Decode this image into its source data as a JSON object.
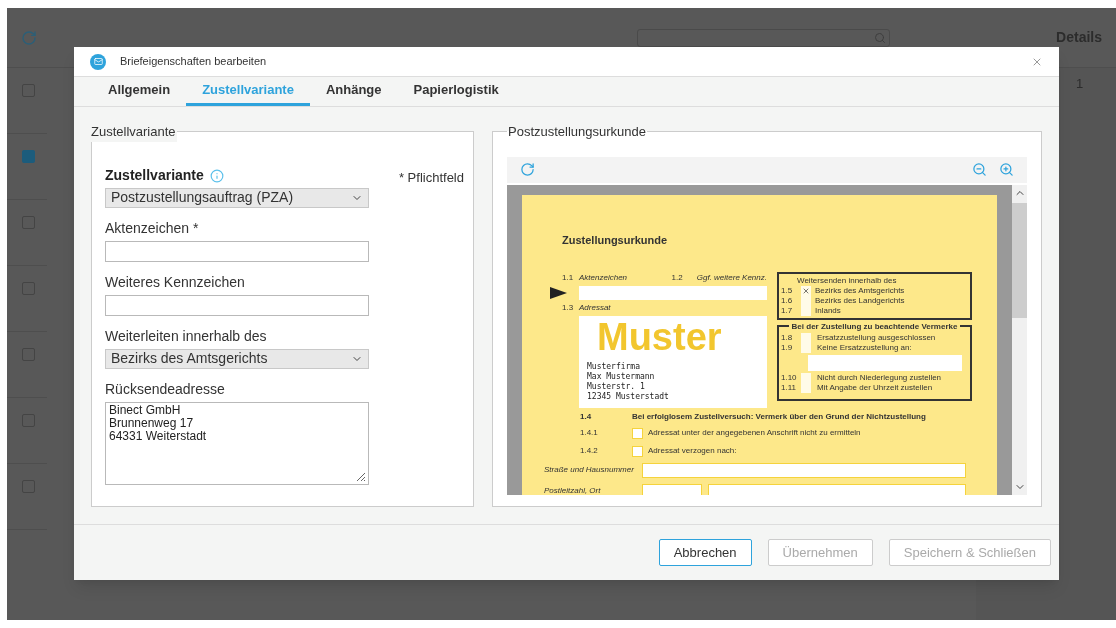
{
  "background": {
    "heading": "Details",
    "page_number": "1",
    "rows": [
      {
        "checked": false
      },
      {
        "checked": true
      },
      {
        "checked": false
      },
      {
        "checked": false
      },
      {
        "checked": false
      },
      {
        "checked": false
      },
      {
        "checked": false
      }
    ]
  },
  "dialog": {
    "title": "Briefeigenschaften bearbeiten",
    "tabs": [
      {
        "label": "Allgemein",
        "selected": false
      },
      {
        "label": "Zustellvariante",
        "selected": true
      },
      {
        "label": "Anhänge",
        "selected": false
      },
      {
        "label": "Papierlogistik",
        "selected": false
      }
    ],
    "left_panel": {
      "legend": "Zustellvariante",
      "required_note": "* Pflichtfeld",
      "fields": [
        {
          "kind": "select",
          "label": "Zustellvariante",
          "emphasized": true,
          "info": true,
          "value": "Postzustellungsauftrag (PZA)"
        },
        {
          "kind": "input",
          "label": "Aktenzeichen *",
          "emphasized": false,
          "info": false
        },
        {
          "kind": "input",
          "label": "Weiteres Kennzeichen",
          "emphasized": false,
          "info": false
        },
        {
          "kind": "select",
          "label": "Weiterleiten innerhalb des",
          "emphasized": false,
          "info": false,
          "value": "Bezirks des Amtsgerichts"
        },
        {
          "kind": "textarea",
          "label": "Rücksendeadresse",
          "emphasized": false,
          "info": false,
          "lines": [
            "Binect GmbH",
            "Brunnenweg 17",
            "64331 Weiterstadt"
          ]
        }
      ]
    },
    "preview": {
      "legend": "Postzustellungsurkunde",
      "document": {
        "title": "Zustellungsurkunde",
        "file_number": {
          "number": "1.1",
          "label": "Aktenzeichen"
        },
        "other_mark": {
          "number": "1.2",
          "label": "Ggf. weitere Kennz."
        },
        "addressee": {
          "number": "1.3",
          "label": "Adressat"
        },
        "stamp": "Muster",
        "address": [
          "Musterfirma",
          "Max Mustermann",
          "Musterstr. 1",
          "12345 Musterstadt"
        ],
        "forward_box": {
          "heading": "Weitersenden innerhalb des",
          "options": [
            {
              "number": "1.5",
              "label": "Bezirks des Amtsgerichts",
              "checked": true
            },
            {
              "number": "1.6",
              "label": "Bezirks des Landgerichts",
              "checked": false
            },
            {
              "number": "1.7",
              "label": "Inlands",
              "checked": false
            }
          ]
        },
        "notes_box": {
          "heading": "Bei der Zustellung zu beachtende Vermerke",
          "options": [
            {
              "kind": "check",
              "number": "1.8",
              "label": "Ersatzzustellung ausgeschlossen",
              "checked": false
            },
            {
              "kind": "check",
              "number": "1.9",
              "label": "Keine Ersatzzustellung an:",
              "checked": false
            },
            {
              "kind": "line"
            },
            {
              "kind": "check",
              "number": "1.10",
              "label": "Nicht durch Niederlegung zustellen",
              "checked": false
            },
            {
              "kind": "check",
              "number": "1.11",
              "label": "Mit Angabe der Uhrzeit zustellen",
              "checked": false
            }
          ]
        },
        "failure": {
          "number": "1.4",
          "heading": "Bei erfolglosem Zustellversuch: Vermerk über den Grund der Nichtzustellung",
          "options": [
            {
              "number": "1.4.1",
              "label": "Adressat unter der angegebenen Anschrift nicht zu ermitteln",
              "checked": false
            },
            {
              "number": "1.4.2",
              "label": "Adressat verzogen nach:",
              "checked": false
            }
          ],
          "street_label": "Straße und Hausnummer",
          "city_label": "Postleitzahl, Ort"
        }
      }
    },
    "buttons": [
      {
        "label": "Abbrechen",
        "disabled": false,
        "focused": true
      },
      {
        "label": "Übernehmen",
        "disabled": true,
        "focused": false
      },
      {
        "label": "Speichern & Schließen",
        "disabled": true,
        "focused": false
      }
    ]
  }
}
